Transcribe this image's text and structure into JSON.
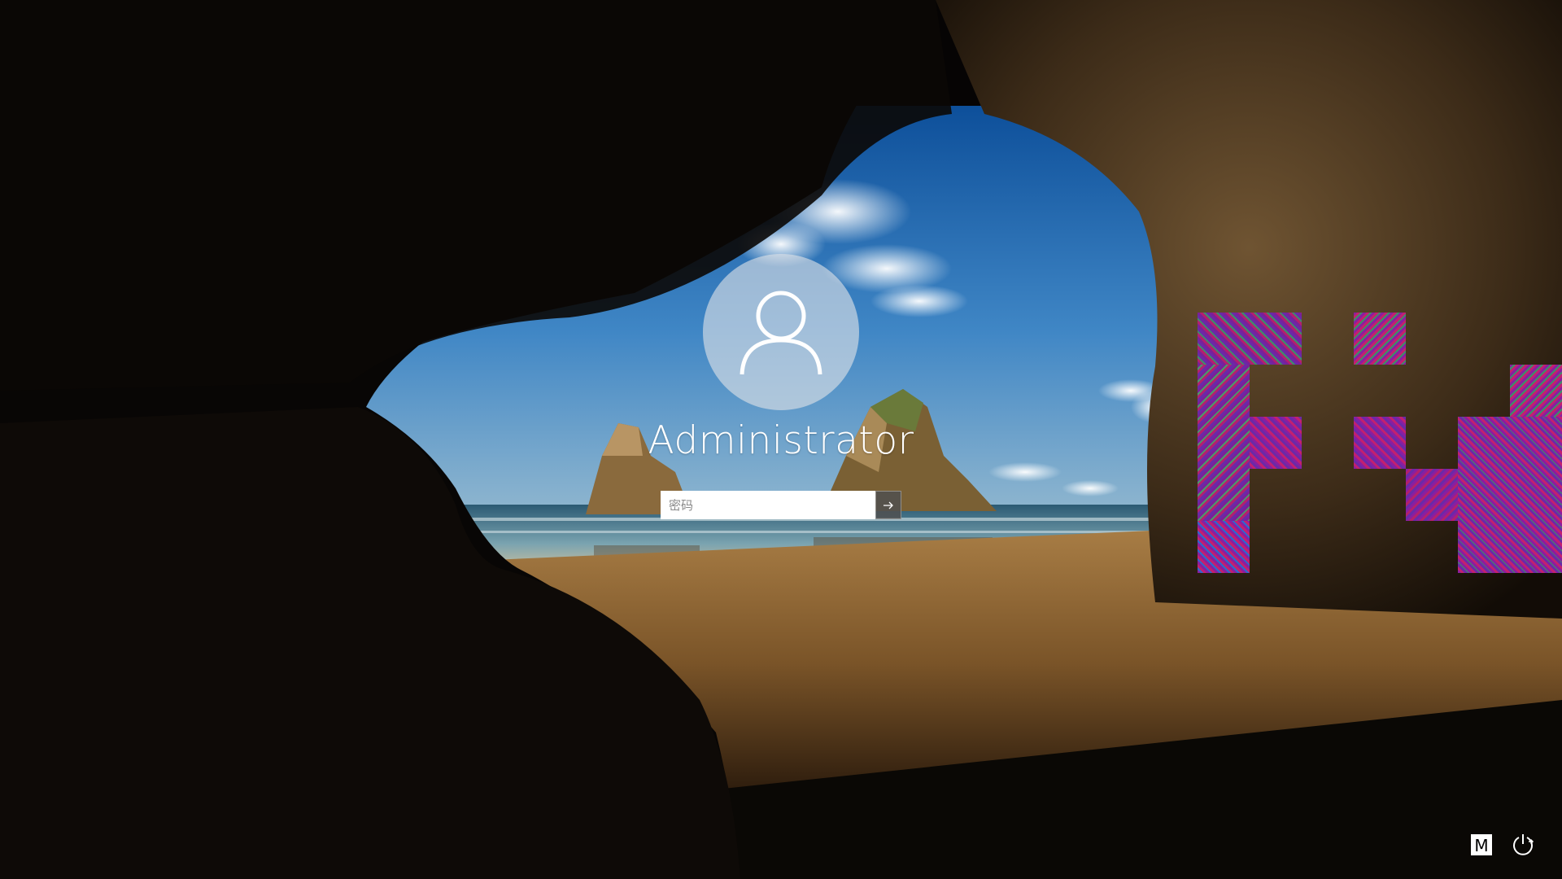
{
  "user": {
    "name": "Administrator"
  },
  "password": {
    "placeholder": "密码",
    "value": ""
  },
  "controls": {
    "ime_label": "M"
  },
  "icons": {
    "avatar": "user-silhouette-icon",
    "submit": "arrow-right-icon",
    "power": "power-icon",
    "ime": "input-method-icon"
  },
  "colors": {
    "avatar_circle": "#dfe2e6",
    "text": "#ffffff",
    "submit_bg": "#505050",
    "glitch": "#8a1ea0"
  }
}
